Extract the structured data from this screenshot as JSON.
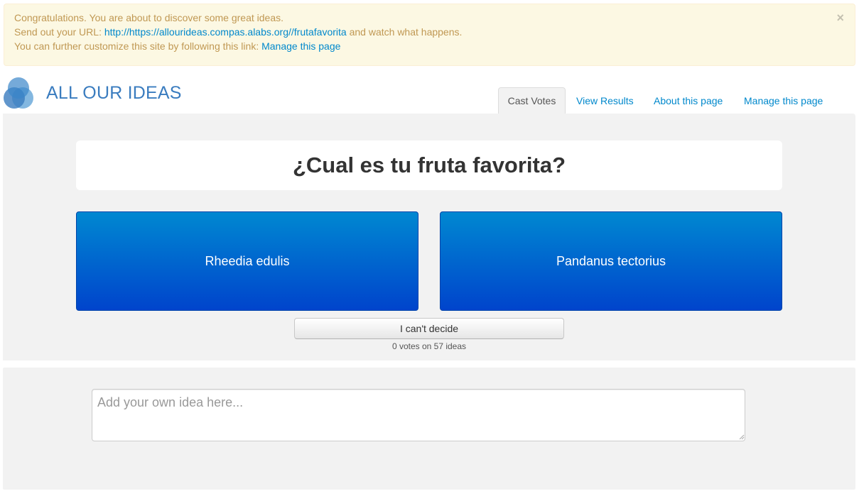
{
  "alert": {
    "line1": "Congratulations. You are about to discover some great ideas.",
    "line2_prefix": "Send out your URL: ",
    "line2_link": "http://https://allourideas.compas.alabs.org//frutafavorita",
    "line2_suffix": " and watch what happens.",
    "line3_prefix": "You can further customize this site by following this link: ",
    "line3_link": "Manage this page",
    "close_symbol": "×"
  },
  "logo": {
    "text": "ALL OUR IDEAS",
    "icon": "three-petal-logo-icon"
  },
  "nav": {
    "tabs": [
      {
        "label": "Cast Votes",
        "active": true
      },
      {
        "label": "View Results",
        "active": false
      },
      {
        "label": "About this page",
        "active": false
      },
      {
        "label": "Manage this page",
        "active": false
      }
    ]
  },
  "vote": {
    "question": "¿Cual es tu fruta favorita?",
    "left_choice": "Rheedia edulis",
    "right_choice": "Pandanus tectorius",
    "cant_decide": "I can't decide",
    "count_text": "0 votes on 57 ideas"
  },
  "add_idea": {
    "placeholder": "Add your own idea here...",
    "value": ""
  },
  "colors": {
    "link": "#0088cc",
    "alert_bg": "#fcf8e3",
    "alert_text": "#c09853",
    "choice_top": "#0088d1",
    "choice_bottom": "#0044cc",
    "logo_blue": "#3a7cbf",
    "panel_bg": "#f2f2f2"
  }
}
